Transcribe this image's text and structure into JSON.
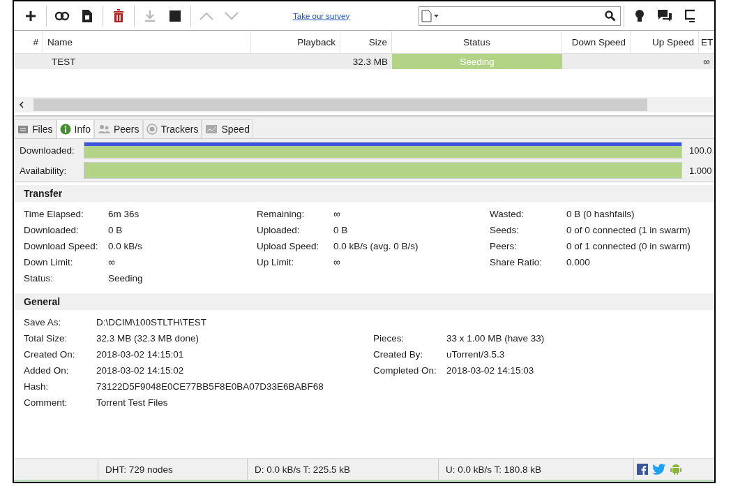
{
  "toolbar": [
    {
      "kind": "add",
      "disabled": false
    },
    {
      "kind": "link",
      "disabled": false
    },
    {
      "kind": "create",
      "disabled": false
    },
    {
      "kind": "delete",
      "disabled": false
    },
    {
      "kind": "download",
      "disabled": true
    },
    {
      "kind": "stop",
      "disabled": false
    },
    {
      "kind": "up",
      "disabled": true
    },
    {
      "kind": "down",
      "disabled": true
    }
  ],
  "survey_link": "Take our survey",
  "right_icons": [
    {
      "kind": "bulb"
    },
    {
      "kind": "chat"
    },
    {
      "kind": "monitor"
    }
  ],
  "table": {
    "columns": [
      "#",
      "Name",
      "Playback",
      "Size",
      "Status",
      "Down Speed",
      "Up Speed",
      "ET"
    ],
    "rows": [
      {
        "name": "TEST",
        "size": "32.3 MB",
        "status": "Seeding",
        "level": 1,
        "eta": "∞",
        "selected": true
      }
    ]
  },
  "tabs": [
    {
      "label": "Files",
      "kind": "files",
      "selected": false
    },
    {
      "label": "Info",
      "kind": "info",
      "selected": true
    },
    {
      "label": "Peers",
      "kind": "peers",
      "selected": false
    },
    {
      "label": "Trackers",
      "kind": "trackers",
      "selected": false
    },
    {
      "label": "Speed",
      "kind": "speed",
      "selected": false
    }
  ],
  "bars": [
    {
      "label": "Downloaded:",
      "level": 1,
      "reading": "100.0",
      "kind": "pieces"
    },
    {
      "label": "Availability:",
      "level": 1,
      "reading": "1.000",
      "kind": "plain"
    }
  ],
  "transfer": {
    "title": "Transfer",
    "columns": [
      [
        {
          "label": "Time Elapsed:",
          "value": "6m 36s"
        },
        {
          "label": "Downloaded:",
          "value": "0 B"
        },
        {
          "label": "Download Speed:",
          "value": "0.0 kB/s"
        },
        {
          "label": "Down Limit:",
          "value": "∞"
        },
        {
          "label": "Status:",
          "value": "Seeding"
        }
      ],
      [
        {
          "label": "Remaining:",
          "value": "∞"
        },
        {
          "label": "Uploaded:",
          "value": "0 B"
        },
        {
          "label": "Upload Speed:",
          "value": "0.0 kB/s (avg. 0 B/s)"
        },
        {
          "label": "Up Limit:",
          "value": "∞"
        }
      ],
      [
        {
          "label": "Wasted:",
          "value": "0 B (0 hashfails)"
        },
        {
          "label": "Seeds:",
          "value": "0 of 0 connected (1 in swarm)"
        },
        {
          "label": "Peers:",
          "value": "0 of 1 connected (0 in swarm)"
        },
        {
          "label": "Share Ratio:",
          "value": "0.000"
        }
      ]
    ]
  },
  "general": {
    "title": "General",
    "rows": [
      {
        "left": {
          "label": "Save As:",
          "value": "D:\\DCIM\\100STLTH\\TEST"
        }
      },
      {
        "left": {
          "label": "Total Size:",
          "value": "32.3 MB (32.3 MB done)"
        },
        "right": {
          "label": "Pieces:",
          "value": "33 x 1.00 MB (have 33)"
        }
      },
      {
        "left": {
          "label": "Created On:",
          "value": "2018-03-02 14:15:01"
        },
        "right": {
          "label": "Created By:",
          "value": "uTorrent/3.5.3"
        }
      },
      {
        "left": {
          "label": "Added On:",
          "value": "2018-03-02 14:15:02"
        },
        "right": {
          "label": "Completed On:",
          "value": "2018-03-02 14:15:03"
        }
      },
      {
        "left": {
          "label": "Hash:",
          "value": "73122D5F9048E0CE77BB5F8E0BA07D33E6BABF68"
        }
      },
      {
        "left": {
          "label": "Comment:",
          "value": "Torrent Test Files"
        }
      }
    ]
  },
  "status_bar": [
    "DHT: 729 nodes",
    "D: 0.0 kB/s T: 225.5 kB",
    "U: 0.0 kB/s T: 180.8 kB"
  ]
}
